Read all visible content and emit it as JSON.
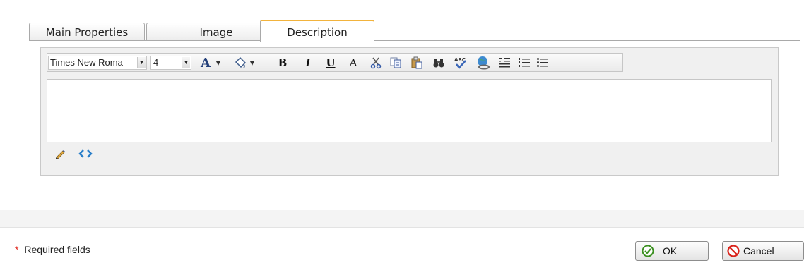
{
  "tabs": {
    "main_properties": "Main Properties",
    "image": "Image",
    "description": "Description",
    "active_color": "#f2b33d"
  },
  "toolbar": {
    "font_name": "Times New Roma",
    "font_size": "4",
    "font_color_icon": "font-color-icon",
    "highlight_icon": "highlight-color-icon",
    "bold": "B",
    "italic": "I",
    "underline": "U",
    "strikethrough": "A",
    "cut_icon": "scissors-icon",
    "copy_icon": "copy-icon",
    "paste_icon": "paste-icon",
    "find_icon": "binoculars-icon",
    "spellcheck_icon": "spellcheck-icon",
    "spellcheck_text": "ABC",
    "link_icon": "globe-link-icon",
    "align_icon": "align-icon",
    "ordered_list_icon": "ordered-list-icon",
    "unordered_list_icon": "unordered-list-icon"
  },
  "editor": {
    "content": "",
    "modes": [
      "design-mode-icon",
      "html-mode-icon"
    ]
  },
  "footer": {
    "required_star": "*",
    "required_label": "Required fields",
    "ok_label": "OK",
    "cancel_label": "Cancel",
    "ok_icon_color": "#3a8f1f",
    "cancel_icon_color": "#d9231b"
  }
}
